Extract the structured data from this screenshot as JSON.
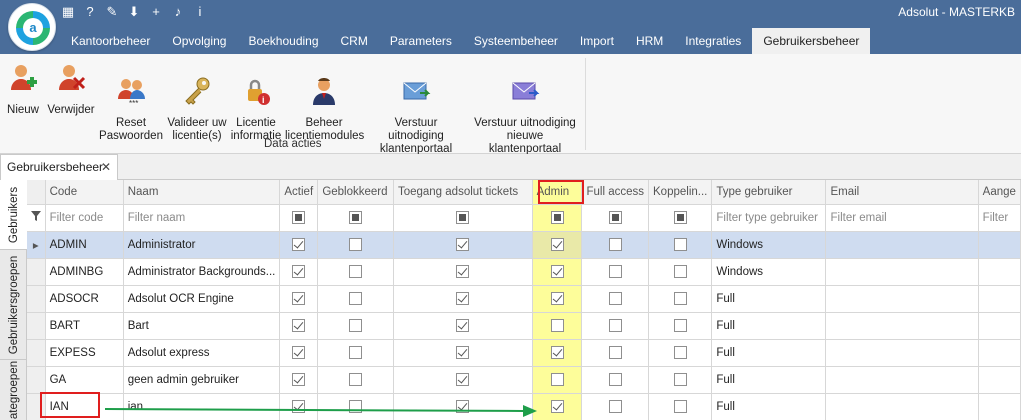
{
  "app": {
    "title": "Adsolut - MASTERKB",
    "logo_letter": "a",
    "quick_access": [
      "calculator-icon",
      "help-icon",
      "pin-icon",
      "download-icon",
      "add-icon",
      "bell-icon",
      "info-icon"
    ],
    "quick_access_glyphs": [
      "▦",
      "?",
      "✎",
      "⬇",
      "+",
      "♪",
      "i"
    ]
  },
  "ribbon_tabs": [
    "Kantoorbeheer",
    "Opvolging",
    "Boekhouding",
    "CRM",
    "Parameters",
    "Systeembeheer",
    "Import",
    "HRM",
    "Integraties",
    "Gebruikersbeheer"
  ],
  "active_ribbon_tab": "Gebruikersbeheer",
  "ribbon": {
    "buttons": [
      {
        "label": "Nieuw",
        "icon": "add-user-icon"
      },
      {
        "label": "Verwijder",
        "icon": "delete-user-icon"
      },
      {
        "label": "Reset\nPaswoorden",
        "icon": "reset-password-icon"
      },
      {
        "label": "Valideer uw\nlicentie(s)",
        "icon": "key-icon"
      },
      {
        "label": "Licentie\ninformatie",
        "icon": "license-info-icon"
      },
      {
        "label": "Beheer\nlicentiemodules",
        "icon": "license-modules-icon"
      },
      {
        "label": "Verstuur uitnodiging\nklantenportaal",
        "icon": "send-invite-icon"
      },
      {
        "label": "Verstuur uitnodiging\nnieuwe klantenportaal",
        "icon": "send-new-invite-icon"
      }
    ],
    "group_label": "Data acties"
  },
  "document_tab": {
    "label": "Gebruikersbeheer",
    "close": "✕"
  },
  "side_tabs": [
    "Gebruikers",
    "Gebruikersgroepen",
    "ategroepen"
  ],
  "grid": {
    "columns": [
      "Code",
      "Naam",
      "Actief",
      "Geblokkeerd",
      "Toegang adsolut tickets",
      "Admin",
      "Full access",
      "Koppelin...",
      "Type gebruiker",
      "Email",
      "Aange"
    ],
    "filters": {
      "code": "Filter code",
      "naam": "Filter naam",
      "type": "Filter type gebruiker",
      "email": "Filter email",
      "last": "Filter"
    },
    "rows": [
      {
        "code": "ADMIN",
        "naam": "Administrator",
        "actief": true,
        "geblokkeerd": false,
        "tickets": true,
        "admin": true,
        "full": false,
        "koppeling": false,
        "type": "Windows",
        "email": "",
        "last": "",
        "selected": true
      },
      {
        "code": "ADMINBG",
        "naam": "Administrator Backgrounds...",
        "actief": true,
        "geblokkeerd": false,
        "tickets": true,
        "admin": true,
        "full": false,
        "koppeling": false,
        "type": "Windows",
        "email": "",
        "last": ""
      },
      {
        "code": "ADSOCR",
        "naam": "Adsolut OCR Engine",
        "actief": true,
        "geblokkeerd": false,
        "tickets": true,
        "admin": true,
        "full": false,
        "koppeling": false,
        "type": "Full",
        "email": "",
        "last": ""
      },
      {
        "code": "BART",
        "naam": "Bart",
        "actief": true,
        "geblokkeerd": false,
        "tickets": true,
        "admin": false,
        "full": false,
        "koppeling": false,
        "type": "Full",
        "email": "",
        "last": ""
      },
      {
        "code": "EXPESS",
        "naam": "Adsolut express",
        "actief": true,
        "geblokkeerd": false,
        "tickets": true,
        "admin": true,
        "full": false,
        "koppeling": false,
        "type": "Full",
        "email": "",
        "last": ""
      },
      {
        "code": "GA",
        "naam": "geen admin gebruiker",
        "actief": true,
        "geblokkeerd": false,
        "tickets": true,
        "admin": false,
        "full": false,
        "koppeling": false,
        "type": "Full",
        "email": "",
        "last": ""
      },
      {
        "code": "IAN",
        "naam": "ian",
        "actief": true,
        "geblokkeerd": false,
        "tickets": true,
        "admin": true,
        "full": false,
        "koppeling": false,
        "type": "Full",
        "email": "",
        "last": ""
      }
    ]
  },
  "colors": {
    "titlebar": "#4a6d9a",
    "admin_highlight": "#fdfd9a",
    "annotation_red": "#e01e1e",
    "annotation_arrow": "#1e9e4a",
    "selected_row": "#cfdcf0"
  }
}
